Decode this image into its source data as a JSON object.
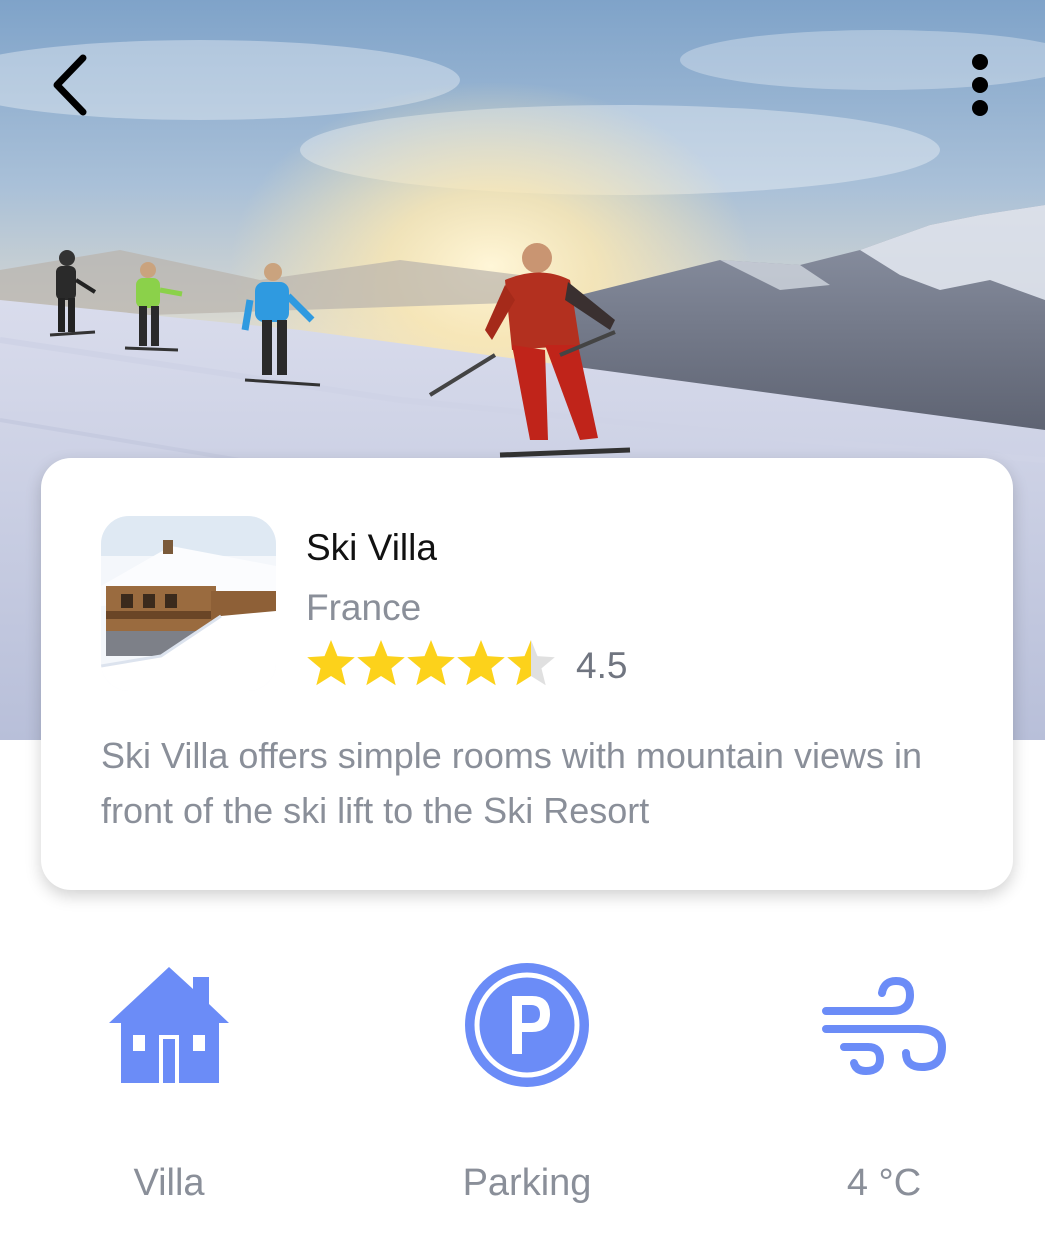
{
  "header": {
    "back_icon": "chevron-left-icon",
    "more_icon": "more-vertical-icon"
  },
  "listing": {
    "title": "Ski Villa",
    "country": "France",
    "rating": 4.5,
    "rating_max": 5,
    "rating_text": "4.5",
    "description": "Ski Villa offers simple rooms with mountain views in front of the ski lift to the Ski Resort"
  },
  "features": [
    {
      "icon": "house-icon",
      "label": "Villa"
    },
    {
      "icon": "parking-icon",
      "label": "Parking"
    },
    {
      "icon": "wind-icon",
      "label": "4 °C"
    }
  ],
  "colors": {
    "accent": "#6b8cf7",
    "star": "#fcd21b",
    "star_empty": "#e0e0e0",
    "muted_text": "#8a8f99"
  }
}
